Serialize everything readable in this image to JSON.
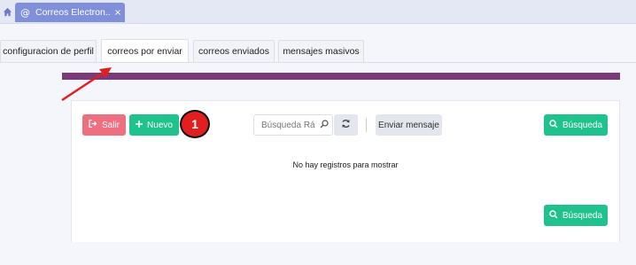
{
  "window": {
    "app_tab_title": "Correos Electron...",
    "app_tab_at": "@",
    "app_tab_close": "×"
  },
  "tabs": [
    {
      "label": "configuracion de perfil"
    },
    {
      "label": "correos por enviar",
      "active": true
    },
    {
      "label": "correos enviados"
    },
    {
      "label": "mensajes masivos"
    }
  ],
  "toolbar": {
    "salir_label": "Salir",
    "nuevo_label": "Nuevo",
    "search_placeholder": "Búsqueda Rá",
    "enviar_label": "Enviar mensaje",
    "busqueda_label": "Búsqueda"
  },
  "content": {
    "empty_message": "No hay registros para mostrar"
  },
  "footer": {
    "busqueda_label": "Búsqueda"
  },
  "annotation": {
    "badge_number": "1"
  },
  "colors": {
    "accent_purple": "#7b3a7a",
    "btn_red": "#ef6f80",
    "btn_green": "#1fc28b",
    "tab_blue": "#7f8fd9",
    "annotation_red": "#e21f1f"
  },
  "icons": [
    "home-icon",
    "at-icon",
    "close-icon",
    "sign-out-icon",
    "plus-icon",
    "search-icon",
    "refresh-icon"
  ]
}
